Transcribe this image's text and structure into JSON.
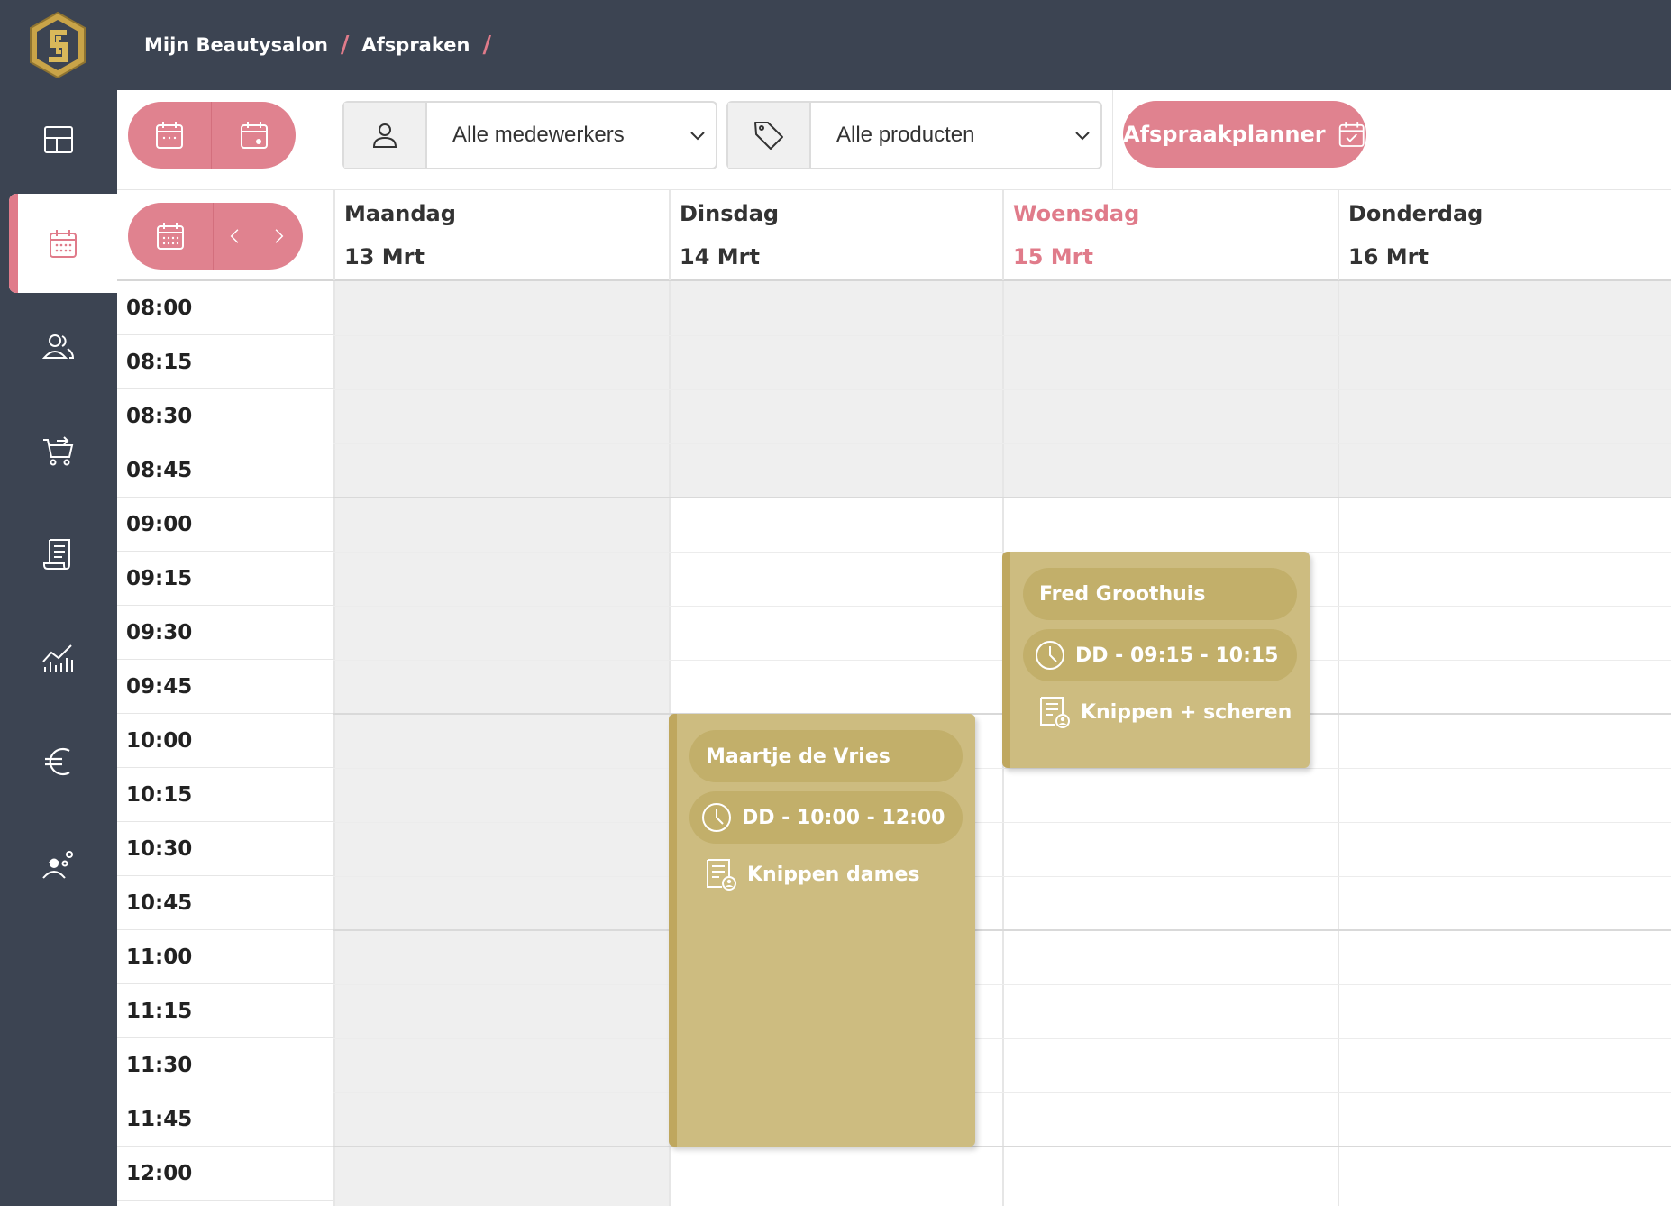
{
  "sidebar": {
    "items": [
      {
        "name": "dashboard",
        "icon": "layout-icon"
      },
      {
        "name": "appointments",
        "icon": "calendar-icon",
        "active": true
      },
      {
        "name": "customers",
        "icon": "users-icon"
      },
      {
        "name": "shop",
        "icon": "cart-icon"
      },
      {
        "name": "invoices",
        "icon": "receipt-icon"
      },
      {
        "name": "reports",
        "icon": "chart-icon"
      },
      {
        "name": "finance",
        "icon": "euro-icon"
      },
      {
        "name": "staff-settings",
        "icon": "user-gear-icon"
      }
    ]
  },
  "breadcrumb": {
    "items": [
      "Mijn Beautysalon",
      "Afspraken"
    ],
    "separator": "/"
  },
  "toolbar": {
    "staff_filter": "Alle medewerkers",
    "product_filter": "Alle producten",
    "planner_button": "Afspraakplanner"
  },
  "calendar": {
    "days": [
      {
        "name": "Maandag",
        "date": "13 Mrt"
      },
      {
        "name": "Dinsdag",
        "date": "14 Mrt"
      },
      {
        "name": "Woensdag",
        "date": "15 Mrt",
        "today": true
      },
      {
        "name": "Donderdag",
        "date": "16 Mrt"
      }
    ],
    "times": [
      "08:00",
      "08:15",
      "08:30",
      "08:45",
      "09:00",
      "09:15",
      "09:30",
      "09:45",
      "10:00",
      "10:15",
      "10:30",
      "10:45",
      "11:00",
      "11:15",
      "11:30",
      "11:45",
      "12:00"
    ],
    "appointments": [
      {
        "customer": "Maartje de Vries",
        "time": "DD - 10:00 - 12:00",
        "service": "Knippen dames"
      },
      {
        "customer": "Fred Groothuis",
        "time": "DD - 09:15 - 10:15",
        "service": "Knippen + scheren"
      }
    ]
  },
  "colors": {
    "sidebar_bg": "#3c4452",
    "accent": "#e0828f",
    "appointment": "#cdbc80",
    "closed_bg": "#efefef"
  }
}
